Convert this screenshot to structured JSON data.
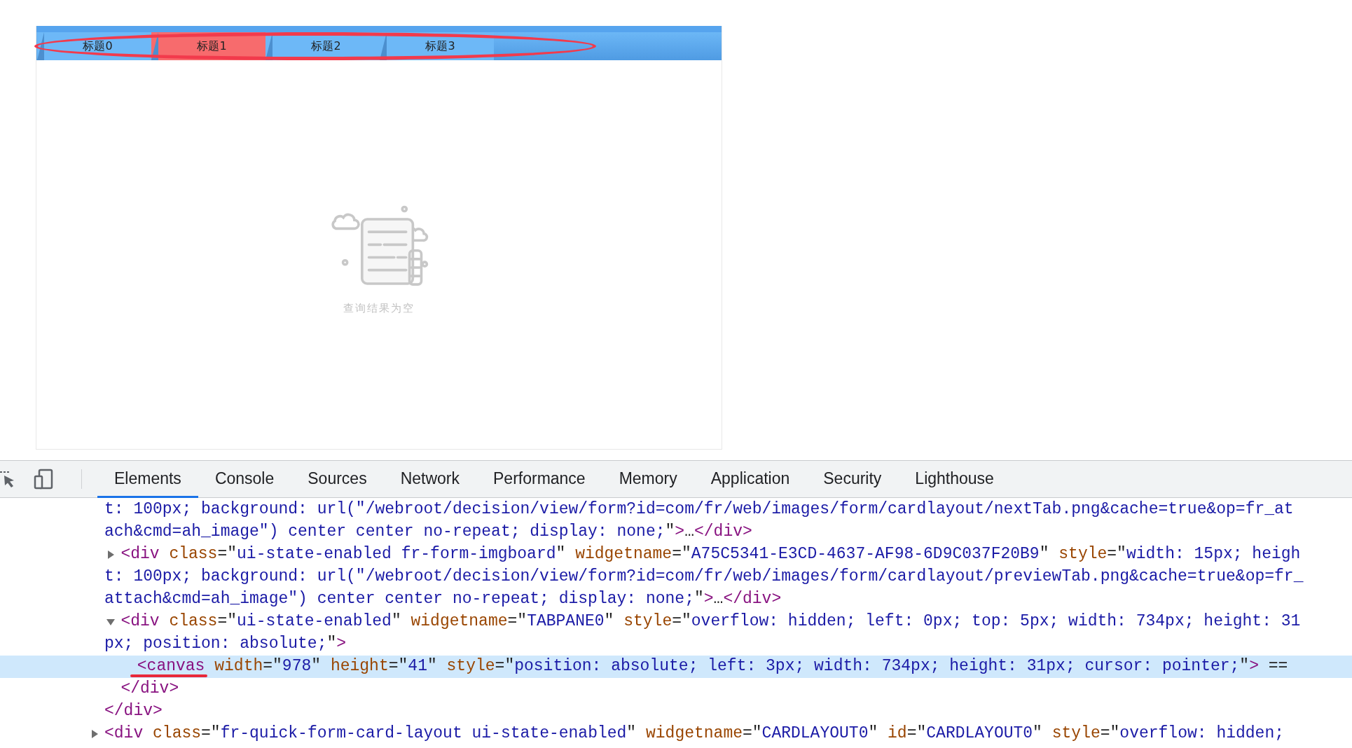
{
  "form": {
    "tabs": [
      {
        "label": "标题0",
        "selected": false
      },
      {
        "label": "标题1",
        "selected": true
      },
      {
        "label": "标题2",
        "selected": false
      },
      {
        "label": "标题3",
        "selected": false
      }
    ],
    "empty_state": {
      "message": "查询结果为空"
    }
  },
  "devtools": {
    "tabs": [
      {
        "label": "Elements",
        "selected": true
      },
      {
        "label": "Console",
        "selected": false
      },
      {
        "label": "Sources",
        "selected": false
      },
      {
        "label": "Network",
        "selected": false
      },
      {
        "label": "Performance",
        "selected": false
      },
      {
        "label": "Memory",
        "selected": false
      },
      {
        "label": "Application",
        "selected": false
      },
      {
        "label": "Security",
        "selected": false
      },
      {
        "label": "Lighthouse",
        "selected": false
      }
    ],
    "dom_tree": [
      {
        "children": [
          {
            "selected": false,
            "lines": [
              {
                "kind": "wrap",
                "segments": [
                  {
                    "kind": "value",
                    "text": "t: 100px; background: url(\"/webroot/decision/view/form?id=com/fr/web/images/form/cardlayout/nextTab.png&cache=true&op=fr_at"
                  }
                ]
              },
              {
                "kind": "wrap",
                "segments": [
                  {
                    "kind": "value",
                    "text": "ach&cmd=ah_image\") center center no-repeat; display: none;"
                  },
                  {
                    "kind": "plain",
                    "text": "\""
                  },
                  {
                    "kind": "tag",
                    "text": ">"
                  },
                  {
                    "kind": "plain",
                    "text": "…"
                  },
                  {
                    "kind": "tag",
                    "text": "</div>"
                  }
                ]
              }
            ]
          },
          {
            "expanded": false,
            "selected": false,
            "lines": [
              {
                "kind": "head",
                "segments": [
                  {
                    "kind": "tag",
                    "text": "<div"
                  },
                  {
                    "kind": "attr",
                    "text": " class"
                  },
                  {
                    "kind": "plain",
                    "text": "=\""
                  },
                  {
                    "kind": "value",
                    "text": "ui-state-enabled fr-form-imgboard"
                  },
                  {
                    "kind": "plain",
                    "text": "\""
                  },
                  {
                    "kind": "attr",
                    "text": " widgetname"
                  },
                  {
                    "kind": "plain",
                    "text": "=\""
                  },
                  {
                    "kind": "value",
                    "text": "A75C5341-E3CD-4637-AF98-6D9C037F20B9"
                  },
                  {
                    "kind": "plain",
                    "text": "\""
                  },
                  {
                    "kind": "attr",
                    "text": " style"
                  },
                  {
                    "kind": "plain",
                    "text": "=\""
                  },
                  {
                    "kind": "value",
                    "text": "width: 15px; heigh"
                  }
                ]
              },
              {
                "kind": "wrap",
                "segments": [
                  {
                    "kind": "value",
                    "text": "t: 100px; background: url(\"/webroot/decision/view/form?id=com/fr/web/images/form/cardlayout/previewTab.png&cache=true&op=fr_"
                  }
                ]
              },
              {
                "kind": "wrap",
                "segments": [
                  {
                    "kind": "value",
                    "text": "attach&cmd=ah_image\") center center no-repeat; display: none;"
                  },
                  {
                    "kind": "plain",
                    "text": "\""
                  },
                  {
                    "kind": "tag",
                    "text": ">"
                  },
                  {
                    "kind": "plain",
                    "text": "…"
                  },
                  {
                    "kind": "tag",
                    "text": "</div>"
                  }
                ]
              }
            ]
          },
          {
            "expanded": true,
            "selected": false,
            "lines": [
              {
                "kind": "head",
                "segments": [
                  {
                    "kind": "tag",
                    "text": "<div"
                  },
                  {
                    "kind": "attr",
                    "text": " class"
                  },
                  {
                    "kind": "plain",
                    "text": "=\""
                  },
                  {
                    "kind": "value",
                    "text": "ui-state-enabled"
                  },
                  {
                    "kind": "plain",
                    "text": "\""
                  },
                  {
                    "kind": "attr",
                    "text": " widgetname"
                  },
                  {
                    "kind": "plain",
                    "text": "=\""
                  },
                  {
                    "kind": "value",
                    "text": "TABPANE0"
                  },
                  {
                    "kind": "plain",
                    "text": "\""
                  },
                  {
                    "kind": "attr",
                    "text": " style"
                  },
                  {
                    "kind": "plain",
                    "text": "=\""
                  },
                  {
                    "kind": "value",
                    "text": "overflow: hidden; left: 0px; top: 5px; width: 734px; height: 31"
                  }
                ]
              },
              {
                "kind": "wrap",
                "segments": [
                  {
                    "kind": "value",
                    "text": "px; position: absolute;"
                  },
                  {
                    "kind": "plain",
                    "text": "\""
                  },
                  {
                    "kind": "tag",
                    "text": ">"
                  }
                ]
              }
            ],
            "children": [
              {
                "selected": true,
                "underlined": true,
                "lines": [
                  {
                    "kind": "head",
                    "segments": [
                      {
                        "kind": "tag",
                        "text": "<canvas"
                      },
                      {
                        "kind": "attr",
                        "text": " width"
                      },
                      {
                        "kind": "plain",
                        "text": "=\""
                      },
                      {
                        "kind": "value",
                        "text": "978"
                      },
                      {
                        "kind": "plain",
                        "text": "\""
                      },
                      {
                        "kind": "attr",
                        "text": " height"
                      },
                      {
                        "kind": "plain",
                        "text": "=\""
                      },
                      {
                        "kind": "value",
                        "text": "41"
                      },
                      {
                        "kind": "plain",
                        "text": "\""
                      },
                      {
                        "kind": "attr",
                        "text": " style"
                      },
                      {
                        "kind": "plain",
                        "text": "=\""
                      },
                      {
                        "kind": "value",
                        "text": "position: absolute; left: 3px; width: 734px; height: 31px; cursor: pointer;"
                      },
                      {
                        "kind": "plain",
                        "text": "\""
                      },
                      {
                        "kind": "tag",
                        "text": ">"
                      },
                      {
                        "kind": "plain",
                        "text": " =="
                      }
                    ]
                  }
                ]
              }
            ],
            "closing": [
              {
                "kind": "tag",
                "text": "</div>"
              }
            ]
          }
        ],
        "closing": [
          {
            "kind": "tag",
            "text": "</div>"
          }
        ]
      },
      {
        "expanded": false,
        "selected": false,
        "lines": [
          {
            "kind": "head",
            "segments": [
              {
                "kind": "tag",
                "text": "<div"
              },
              {
                "kind": "attr",
                "text": " class"
              },
              {
                "kind": "plain",
                "text": "=\""
              },
              {
                "kind": "value",
                "text": "fr-quick-form-card-layout ui-state-enabled"
              },
              {
                "kind": "plain",
                "text": "\""
              },
              {
                "kind": "attr",
                "text": " widgetname"
              },
              {
                "kind": "plain",
                "text": "=\""
              },
              {
                "kind": "value",
                "text": "CARDLAYOUT0"
              },
              {
                "kind": "plain",
                "text": "\""
              },
              {
                "kind": "attr",
                "text": " id"
              },
              {
                "kind": "plain",
                "text": "=\""
              },
              {
                "kind": "value",
                "text": "CARDLAYOUT0"
              },
              {
                "kind": "plain",
                "text": "\""
              },
              {
                "kind": "attr",
                "text": " style"
              },
              {
                "kind": "plain",
                "text": "=\""
              },
              {
                "kind": "value",
                "text": "overflow: hidden;"
              }
            ]
          }
        ]
      }
    ]
  }
}
